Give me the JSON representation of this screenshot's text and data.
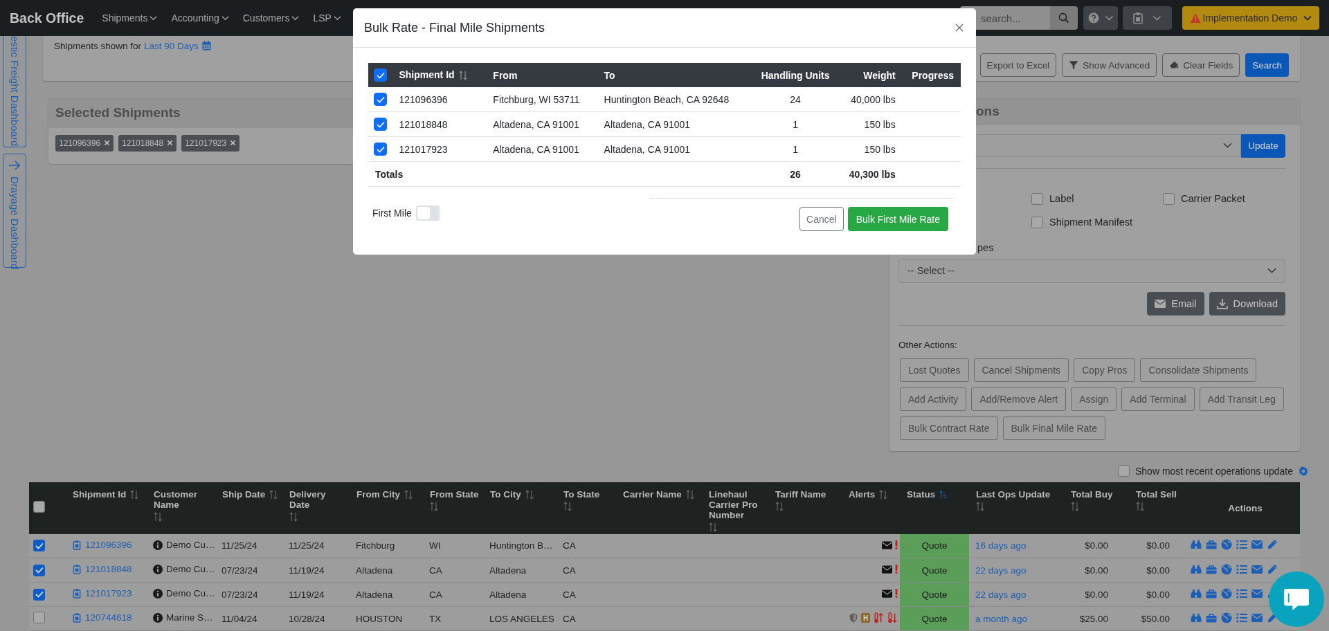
{
  "navbar": {
    "brand": "Back Office",
    "menus": [
      {
        "label": "Shipments"
      },
      {
        "label": "Accounting"
      },
      {
        "label": "Customers"
      },
      {
        "label": "LSP"
      }
    ],
    "search": {
      "placeholder": "search..."
    },
    "environment": {
      "label": "Implementation Demo"
    }
  },
  "side_tabs": [
    {
      "label": "estic Freight Dashboard",
      "kind": "plain"
    },
    {
      "label": "Drayage Dashboard",
      "kind": "arrow"
    }
  ],
  "filter_card": {
    "prefix": "Shipments shown for",
    "range": "Last 90 Days",
    "buttons": [
      {
        "label": "Export to Excel",
        "kind": "plain"
      },
      {
        "label": "Show Advanced",
        "kind": "filter"
      },
      {
        "label": "Clear Fields",
        "kind": "eraser"
      },
      {
        "label": "Search",
        "kind": "primary"
      }
    ]
  },
  "selected_shipments": {
    "title": "Selected Shipments",
    "tags": [
      "121096396",
      "121018848",
      "121017923"
    ]
  },
  "actions_panel": {
    "title_fragment": "ons",
    "update_button": "Update",
    "documents": [
      {
        "label": "Label",
        "checked": false
      },
      {
        "label": "Carrier Packet",
        "checked": false
      },
      {
        "label": "Shipment Manifest",
        "checked": false
      }
    ],
    "types_fragment": "pes",
    "select": {
      "value": "-- Select --"
    },
    "send_buttons": [
      {
        "label": "Email",
        "kind": "email"
      },
      {
        "label": "Download",
        "kind": "download"
      }
    ],
    "other_actions_label": "Other Actions:",
    "other_actions": [
      [
        "Lost Quotes",
        "Cancel Shipments",
        "Copy Pros",
        "Consolidate Shipments"
      ],
      [
        "Add Activity",
        "Add/Remove Alert",
        "Assign",
        "Add Terminal",
        "Add Transit Leg"
      ],
      [
        "Bulk Contract Rate",
        "Bulk Final Mile Rate"
      ]
    ]
  },
  "recent_ops": {
    "label": "Show most recent operations update",
    "checked": false
  },
  "table": {
    "all_selected": false,
    "columns": [
      {
        "label": "Shipment Id",
        "sortable": true,
        "sorted": false
      },
      {
        "label": "Customer Name",
        "sortable": true,
        "sorted": false
      },
      {
        "label": "Ship Date",
        "sortable": true,
        "sorted": false
      },
      {
        "label": "Delivery Date",
        "sortable": true,
        "sorted": false
      },
      {
        "label": "From City",
        "sortable": true,
        "sorted": false
      },
      {
        "label": "From State",
        "sortable": true,
        "sorted": false
      },
      {
        "label": "To City",
        "sortable": true,
        "sorted": false
      },
      {
        "label": "To State",
        "sortable": true,
        "sorted": false
      },
      {
        "label": "Carrier Name",
        "sortable": true,
        "sorted": false
      },
      {
        "label": "Linehaul Carrier Pro Number",
        "sortable": true,
        "sorted": false
      },
      {
        "label": "Tariff Name",
        "sortable": true,
        "sorted": false
      },
      {
        "label": "Alerts",
        "sortable": true,
        "sorted": false
      },
      {
        "label": "Status",
        "sortable": true,
        "sorted": true
      },
      {
        "label": "Last Ops Update",
        "sortable": true,
        "sorted": false
      },
      {
        "label": "Total Buy",
        "sortable": true,
        "sorted": false
      },
      {
        "label": "Total Sell",
        "sortable": true,
        "sorted": false
      },
      {
        "label": "Actions",
        "sortable": false,
        "sorted": false
      }
    ],
    "rows": [
      {
        "selected": true,
        "shipment_id": "121096396",
        "customer": "Demo Cu…",
        "ship_date": "11/25/24",
        "delivery_date": "11/25/24",
        "from_city": "Fitchburg",
        "from_state": "WI",
        "to_city": "Huntington B…",
        "to_state": "CA",
        "alerts": [
          {
            "kind": "mail"
          },
          {
            "kind": "exclamation"
          }
        ],
        "status": "Quote",
        "last_update": "16 days ago",
        "total_buy": "$0.00",
        "total_sell": "$0.00"
      },
      {
        "selected": true,
        "shipment_id": "121018848",
        "customer": "Demo Cu…",
        "ship_date": "07/23/24",
        "delivery_date": "11/19/24",
        "from_city": "Altadena",
        "from_state": "CA",
        "to_city": "Altadena",
        "to_state": "CA",
        "alerts": [
          {
            "kind": "mail"
          },
          {
            "kind": "exclamation"
          }
        ],
        "status": "Quote",
        "last_update": "22 days ago",
        "total_buy": "$0.00",
        "total_sell": "$0.00"
      },
      {
        "selected": true,
        "shipment_id": "121017923",
        "customer": "Demo Cu…",
        "ship_date": "07/23/24",
        "delivery_date": "11/19/24",
        "from_city": "Altadena",
        "from_state": "CA",
        "to_city": "Altadena",
        "to_state": "CA",
        "alerts": [
          {
            "kind": "mail"
          },
          {
            "kind": "exclamation"
          }
        ],
        "status": "Quote",
        "last_update": "22 days ago",
        "total_buy": "$0.00",
        "total_sell": "$0.00"
      },
      {
        "selected": false,
        "shipment_id": "120744618",
        "customer": "Marine S…",
        "ship_date": "11/04/24",
        "delivery_date": "10/28/24",
        "from_city": "HOUSTON",
        "from_state": "TX",
        "to_city": "LOS ANGELES",
        "to_state": "CA",
        "alerts": [
          {
            "kind": "shield"
          },
          {
            "kind": "badge",
            "text": "H"
          },
          {
            "kind": "temp-up"
          },
          {
            "kind": "temp-down"
          }
        ],
        "status": "Quote",
        "last_update": "a month ago",
        "total_buy": "$25.00",
        "total_sell": "$50.00"
      }
    ]
  },
  "modal": {
    "title": "Bulk Rate - Final Mile Shipments",
    "all_selected": true,
    "columns": [
      {
        "label": "Shipment Id",
        "sortable": true
      },
      {
        "label": "From",
        "sortable": false
      },
      {
        "label": "To",
        "sortable": false
      },
      {
        "label": "Handling Units",
        "sortable": false
      },
      {
        "label": "Weight",
        "sortable": false
      },
      {
        "label": "Progress",
        "sortable": false
      }
    ],
    "rows": [
      {
        "selected": true,
        "id": "121096396",
        "from": "Fitchburg, WI 53711",
        "to": "Huntington Beach, CA 92648",
        "units": "24",
        "weight": "40,000 lbs"
      },
      {
        "selected": true,
        "id": "121018848",
        "from": "Altadena, CA 91001",
        "to": "Altadena, CA 91001",
        "units": "1",
        "weight": "150 lbs"
      },
      {
        "selected": true,
        "id": "121017923",
        "from": "Altadena, CA 91001",
        "to": "Altadena, CA 91001",
        "units": "1",
        "weight": "150 lbs"
      }
    ],
    "totals": {
      "label": "Totals",
      "units": "26",
      "weight": "40,300 lbs"
    },
    "first_mile": {
      "label": "First Mile",
      "on": false
    },
    "buttons": [
      {
        "label": "Cancel",
        "kind": "secondary"
      },
      {
        "label": "Bulk First Mile Rate",
        "kind": "primary"
      }
    ]
  }
}
